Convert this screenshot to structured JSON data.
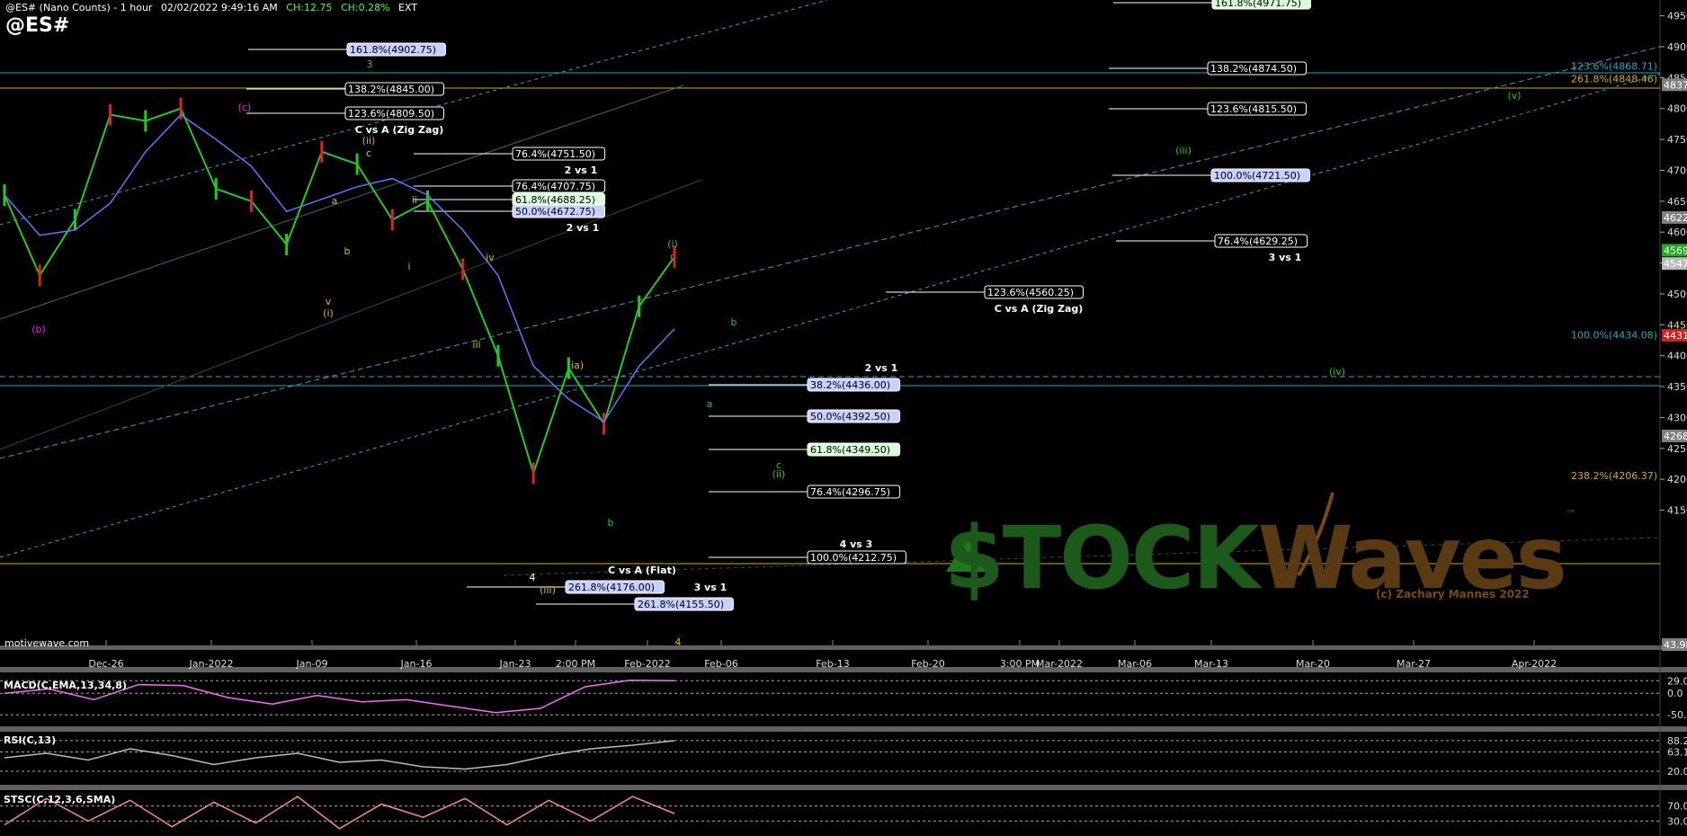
{
  "header": {
    "instrument": "@ES# (Nano Counts) - 1 hour",
    "datetime": "02/02/2022 9:49:16 AM",
    "change": "CH:12.75",
    "change_pct": "CH:0.28%",
    "session": "EXT",
    "symbol": "@ES#"
  },
  "watermark": {
    "brand_left": "$TOCK",
    "brand_right": "Waves",
    "trademark": "™",
    "copyright": "(c) Zachary Mannes 2022",
    "source": "motivewave.com"
  },
  "colors": {
    "up": "#22cc22",
    "down": "#dd2222",
    "white_fib": "#ffffff",
    "blue_fib": "#c8d0ff",
    "green_fib": "#d8ffd8",
    "yellow_line": "#d4b000",
    "cyan_line": "#2aa8b8",
    "wave_yellow": "#d4c000",
    "wave_green": "#22cc22",
    "wave_magenta": "#ee22ee"
  },
  "chart_data": [
    {
      "type": "line",
      "title": "@ES# (Nano Counts) - 1 hour",
      "y_axis": {
        "ticks": [
          4150,
          4200,
          4250,
          4300,
          4350,
          4400,
          4450,
          4500,
          4550,
          4600,
          4650,
          4700,
          4750,
          4800,
          4850,
          4900,
          4950
        ],
        "ylim": [
          4130,
          4970
        ]
      },
      "x_axis": {
        "ticks": [
          "Dec-26",
          "Jan-2022",
          "Jan-09",
          "Jan-16",
          "Jan-23",
          "2:00 PM",
          "Feb-2022",
          "Feb-06",
          "Feb-13",
          "Feb-20",
          "3:00 PM",
          "Mar-2022",
          "Mar-06",
          "Mar-13",
          "Mar-20",
          "Mar-27",
          "Apr-2022"
        ]
      },
      "price_badges": [
        {
          "label": "4837.00",
          "value": 4837,
          "color": "#808080"
        },
        {
          "label": "4622.25",
          "value": 4622.25,
          "color": "#808080"
        },
        {
          "label": "4569.25",
          "value": 4569.25,
          "color": "#22aa22"
        },
        {
          "label": "4547.75",
          "value": 4547.75,
          "color": "#bbbbbb"
        },
        {
          "label": "4431.50",
          "value": 4431.5,
          "color": "#cc2222"
        },
        {
          "label": "4268.75",
          "value": 4268.75,
          "color": "#808080"
        },
        {
          "label": "43.9K",
          "value": 4132,
          "color": "#808080"
        }
      ],
      "right_level_labels": [
        {
          "text": "123.6%(4868.71)",
          "value": 4868.71,
          "color": "#2aa8b8"
        },
        {
          "text": "261.8%(4848.46)",
          "value": 4848.46,
          "color": "#d4b000"
        },
        {
          "text": "100.0%(4434.08)",
          "value": 4434.08,
          "color": "#2aa8b8"
        },
        {
          "text": "238.2%(4206.37)",
          "value": 4206.37,
          "color": "#d4b000"
        }
      ],
      "fib_labels": [
        {
          "text": "161.8%(4902.75)",
          "value": 4902.75,
          "style": "blue"
        },
        {
          "text": "138.2%(4845.00)",
          "value": 4845,
          "style": "white"
        },
        {
          "text": "123.6%(4809.50)",
          "value": 4809.5,
          "style": "white"
        },
        {
          "text": "76.4%(4751.50)",
          "value": 4751.5,
          "style": "white"
        },
        {
          "text": "76.4%(4707.75)",
          "value": 4707.75,
          "style": "white"
        },
        {
          "text": "61.8%(4688.25)",
          "value": 4688.25,
          "style": "green"
        },
        {
          "text": "50.0%(4672.75)",
          "value": 4672.75,
          "style": "blue"
        },
        {
          "text": "123.6%(4560.25)",
          "value": 4560.25,
          "style": "white"
        },
        {
          "text": "38.2%(4436.00)",
          "value": 4436,
          "style": "blue"
        },
        {
          "text": "50.0%(4392.50)",
          "value": 4392.5,
          "style": "blue"
        },
        {
          "text": "61.8%(4349.50)",
          "value": 4349.5,
          "style": "green"
        },
        {
          "text": "76.4%(4296.75)",
          "value": 4296.75,
          "style": "white"
        },
        {
          "text": "100.0%(4212.75)",
          "value": 4212.75,
          "style": "white"
        },
        {
          "text": "261.8%(4176.00)",
          "value": 4176,
          "style": "blue"
        },
        {
          "text": "261.8%(4155.50)",
          "value": 4155.5,
          "style": "blue"
        },
        {
          "text": "161.8%(4971.75)",
          "value": 4971.75,
          "style": "green"
        },
        {
          "text": "138.2%(4874.50)",
          "value": 4874.5,
          "style": "white"
        },
        {
          "text": "123.6%(4815.50)",
          "value": 4815.5,
          "style": "white"
        },
        {
          "text": "100.0%(4721.50)",
          "value": 4721.5,
          "style": "blue"
        },
        {
          "text": "76.4%(4629.25)",
          "value": 4629.25,
          "style": "white"
        }
      ],
      "annotations": [
        "C vs A (Zig Zag)",
        "2 vs 1",
        "2 vs 1",
        "C vs A (Zig Zag)",
        "2 vs 1",
        "4 vs 3",
        "C vs A (Flat)",
        "3 vs 1",
        "3 vs 1"
      ],
      "wave_labels": [
        "(b)",
        "(c)",
        "(ii)",
        "c",
        "i",
        "ii",
        "iii",
        "iv",
        "v",
        "(i)",
        "a",
        "b",
        "4",
        "(iii)",
        "(ia)",
        "b",
        "(i)",
        "c",
        "b",
        "a",
        "c",
        "(ii)",
        "(iii)",
        "(iv)",
        "(v)",
        "3",
        "4"
      ],
      "series": [
        {
          "name": "@ES#",
          "x": [
            "Dec-22",
            "Dec-24",
            "Dec-27",
            "Dec-30",
            "Jan-03",
            "Jan-04",
            "Jan-05",
            "Jan-07",
            "Jan-10",
            "Jan-12",
            "Jan-13",
            "Jan-14",
            "Jan-18",
            "Jan-19",
            "Jan-21",
            "Jan-24",
            "Jan-26",
            "Jan-28",
            "Jan-31",
            "Feb-02"
          ],
          "values": [
            4660,
            4530,
            4620,
            4790,
            4780,
            4800,
            4670,
            4650,
            4580,
            4730,
            4710,
            4620,
            4650,
            4540,
            4400,
            4210,
            4380,
            4290,
            4480,
            4560
          ]
        }
      ]
    },
    {
      "type": "line",
      "title": "MACD(C,EMA,13,34,8)",
      "y_axis": {
        "ticks": [
          29.0,
          0.0,
          -50.0
        ]
      },
      "badges": [
        {
          "label": "29.0",
          "value": 29.0
        }
      ],
      "series": [
        {
          "name": "MACD",
          "values": [
            0,
            10,
            -15,
            20,
            18,
            -10,
            -25,
            -5,
            -20,
            -15,
            -30,
            -45,
            -35,
            15,
            30,
            29
          ]
        }
      ]
    },
    {
      "type": "line",
      "title": "RSI(C,13)",
      "y_axis": {
        "ticks": [
          88.2,
          63.1,
          20.0
        ]
      },
      "badges": [
        {
          "label": "88.2",
          "value": 88.2
        },
        {
          "label": "63.1",
          "value": 63.1
        }
      ],
      "series": [
        {
          "name": "RSI",
          "values": [
            50,
            60,
            45,
            70,
            55,
            35,
            50,
            60,
            40,
            45,
            30,
            25,
            35,
            55,
            70,
            78,
            88
          ]
        }
      ]
    },
    {
      "type": "line",
      "title": "STSC(C,12,3,6,SMA)",
      "y_axis": {
        "ticks": [
          70.0,
          30.0
        ]
      },
      "badges": [
        {
          "label": "70.00000",
          "value": 70.0
        },
        {
          "label": "30.00000",
          "value": 30.0
        }
      ],
      "series": [
        {
          "name": "STSC",
          "values": [
            20,
            90,
            30,
            85,
            15,
            80,
            25,
            95,
            10,
            75,
            40,
            90,
            20,
            85,
            30,
            95,
            50
          ]
        }
      ]
    }
  ]
}
